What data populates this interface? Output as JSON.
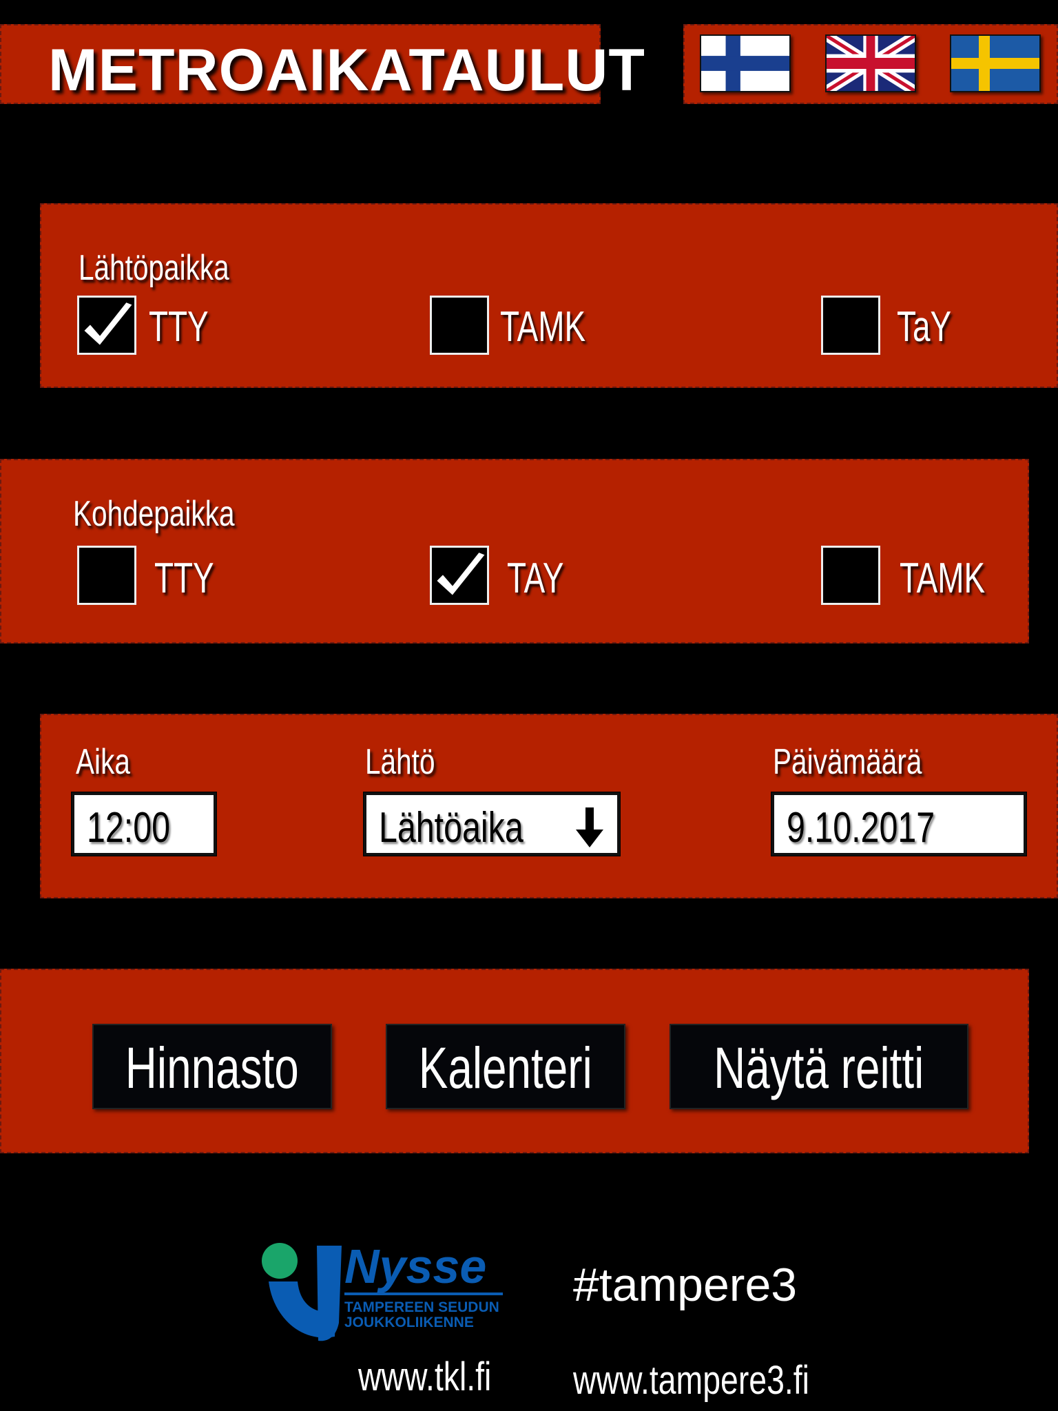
{
  "header": {
    "title": "METROAIKATAULUT",
    "languages": [
      {
        "name": "finnish-flag-icon"
      },
      {
        "name": "uk-flag-icon"
      },
      {
        "name": "swedish-flag-icon"
      }
    ]
  },
  "departure": {
    "label": "Lähtöpaikka",
    "options": [
      {
        "label": "TTY",
        "checked": true
      },
      {
        "label": "TAMK",
        "checked": false
      },
      {
        "label": "TaY",
        "checked": false
      }
    ]
  },
  "destination": {
    "label": "Kohdepaikka",
    "options": [
      {
        "label": "TTY",
        "checked": false
      },
      {
        "label": "TAY",
        "checked": true
      },
      {
        "label": "TAMK",
        "checked": false
      }
    ]
  },
  "time": {
    "time_label": "Aika",
    "time_value": "12:00",
    "mode_label": "Lähtö",
    "mode_value": "Lähtöaika",
    "date_label": "Päivämäärä",
    "date_value": "9.10.2017"
  },
  "buttons": {
    "prices": "Hinnasto",
    "calendar": "Kalenteri",
    "show_route": "Näytä reitti"
  },
  "footer": {
    "logo_text": "Nysse",
    "logo_sub1": "TAMPEREEN SEUDUN",
    "logo_sub2": "JOUKKOLIIKENNE",
    "hashtag": "#tampere3",
    "tkl_url": "www.tkl.fi",
    "tampere3_url": "www.tampere3.fi"
  },
  "colors": {
    "panel": "#b52100",
    "background": "#000000",
    "button": "#05060a",
    "nysse_blue": "#0a5cb3",
    "nysse_green": "#1aa56a"
  }
}
